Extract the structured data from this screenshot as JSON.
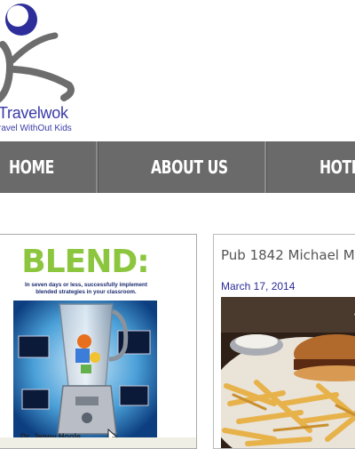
{
  "logo": {
    "name": "Travelwok",
    "tagline": "ravel WithOut Kids",
    "icon": "travelwok-figure-logo",
    "colors": {
      "circle": "#2e2e9a",
      "figure": "#6d6d6d"
    }
  },
  "nav": {
    "background": "#6a6a6a",
    "items": [
      {
        "label": "HOME"
      },
      {
        "label": "ABOUT US"
      },
      {
        "label": "HOTEL"
      }
    ]
  },
  "sidebar_book": {
    "title": "BLEND:",
    "subtitle": "In seven days or less, successfully implement blended strategies in your classroom.",
    "author": "Dr. Jenny Hoole",
    "colors": {
      "title": "#8cc63f"
    }
  },
  "post": {
    "title": "Pub 1842 Michael M",
    "date": "March 17, 2014",
    "date_color": "#2b2b9a"
  }
}
